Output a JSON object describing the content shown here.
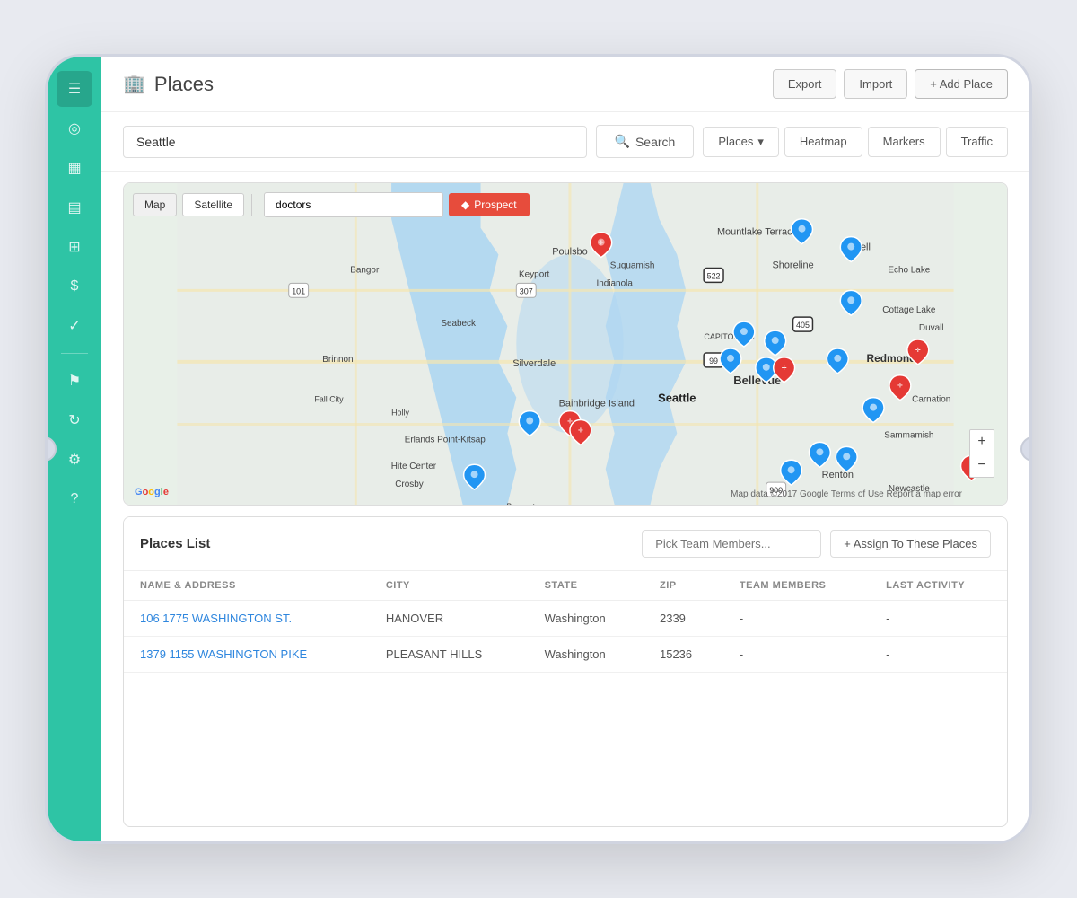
{
  "app": {
    "title": "Places",
    "building_icon": "🏢"
  },
  "header": {
    "export_label": "Export",
    "import_label": "Import",
    "add_place_label": "+ Add Place"
  },
  "search": {
    "location_value": "Seattle",
    "location_placeholder": "Seattle",
    "search_button_label": "Search",
    "search_icon": "🔍",
    "filter_places_label": "Places",
    "filter_heatmap_label": "Heatmap",
    "filter_markers_label": "Markers",
    "filter_traffic_label": "Traffic"
  },
  "map": {
    "view_map_label": "Map",
    "view_satellite_label": "Satellite",
    "search_query": "doctors",
    "prospect_button_label": "Prospect",
    "prospect_icon": "◆",
    "attribution": "Map data ©2017 Google  Terms of Use  Report a map error",
    "google_logo": "Google",
    "zoom_in": "+",
    "zoom_out": "−"
  },
  "places_list": {
    "title": "Places List",
    "team_placeholder": "Pick Team Members...",
    "assign_label": "+ Assign To These Places",
    "columns": {
      "name": "NAME & ADDRESS",
      "city": "CITY",
      "state": "STATE",
      "zip": "ZIP",
      "team_members": "TEAM MEMBERS",
      "last_activity": "LAST ACTIVITY"
    },
    "rows": [
      {
        "name": "106 1775 WASHINGTON ST.",
        "city": "HANOVER",
        "state": "Washington",
        "zip": "2339",
        "team_members": "-",
        "last_activity": "-"
      },
      {
        "name": "1379 1155 WASHINGTON PIKE",
        "city": "PLEASANT HILLS",
        "state": "Washington",
        "zip": "15236",
        "team_members": "-",
        "last_activity": "-"
      }
    ]
  },
  "sidebar": {
    "icons": [
      {
        "name": "menu-icon",
        "symbol": "☰"
      },
      {
        "name": "globe-icon",
        "symbol": "◎"
      },
      {
        "name": "calendar-icon",
        "symbol": "▦"
      },
      {
        "name": "chart-icon",
        "symbol": "▤"
      },
      {
        "name": "briefcase-icon",
        "symbol": "⊞"
      },
      {
        "name": "dollar-icon",
        "symbol": "$"
      },
      {
        "name": "check-icon",
        "symbol": "✓"
      },
      {
        "name": "flag-icon",
        "symbol": "⚑"
      },
      {
        "name": "refresh-icon",
        "symbol": "↻"
      },
      {
        "name": "settings-icon",
        "symbol": "⚙"
      },
      {
        "name": "help-icon",
        "symbol": "?"
      }
    ]
  },
  "colors": {
    "sidebar_bg": "#2ec4a5",
    "primary_blue": "#2e86de",
    "red": "#e53935",
    "pin_blue": "#2196F3",
    "pin_red": "#e53935"
  }
}
